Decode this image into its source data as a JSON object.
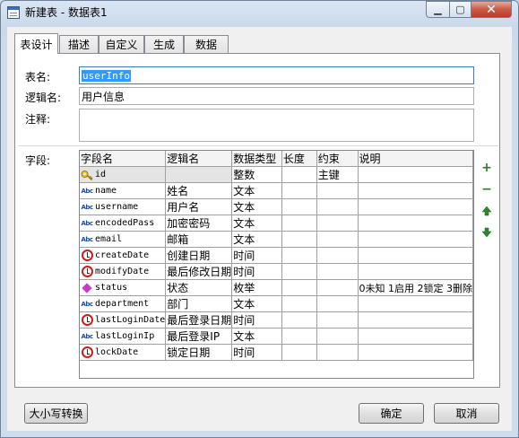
{
  "window": {
    "title": "新建表 - 数据表1"
  },
  "tabs": [
    {
      "label": "表设计",
      "active": true
    },
    {
      "label": "描述"
    },
    {
      "label": "自定义"
    },
    {
      "label": "生成"
    },
    {
      "label": "数据"
    }
  ],
  "form": {
    "table_name_label": "表名:",
    "table_name_value": "userInfo",
    "logic_name_label": "逻辑名:",
    "logic_name_value": "用户信息",
    "comment_label": "注释:",
    "comment_value": "",
    "fields_label": "字段:"
  },
  "grid": {
    "columns": [
      "字段名",
      "逻辑名",
      "数据类型",
      "长度",
      "约束",
      "说明"
    ],
    "rows": [
      {
        "icon": "key-icon",
        "name": "id",
        "logic": "",
        "type": "整数",
        "length": "",
        "constraint": "主键",
        "desc": ""
      },
      {
        "icon": "abc-icon",
        "name": "name",
        "logic": "姓名",
        "type": "文本",
        "length": "",
        "constraint": "",
        "desc": ""
      },
      {
        "icon": "abc-icon",
        "name": "username",
        "logic": "用户名",
        "type": "文本",
        "length": "",
        "constraint": "",
        "desc": ""
      },
      {
        "icon": "abc-icon",
        "name": "encodedPass",
        "logic": "加密密码",
        "type": "文本",
        "length": "",
        "constraint": "",
        "desc": ""
      },
      {
        "icon": "abc-icon",
        "name": "email",
        "logic": "邮箱",
        "type": "文本",
        "length": "",
        "constraint": "",
        "desc": ""
      },
      {
        "icon": "clock-icon",
        "name": "createDate",
        "logic": "创建日期",
        "type": "时间",
        "length": "",
        "constraint": "",
        "desc": ""
      },
      {
        "icon": "clock-icon",
        "name": "modifyDate",
        "logic": "最后修改日期",
        "type": "时间",
        "length": "",
        "constraint": "",
        "desc": ""
      },
      {
        "icon": "enum-icon",
        "name": "status",
        "logic": "状态",
        "type": "枚举",
        "length": "",
        "constraint": "",
        "desc": "0未知 1启用 2锁定 3删除"
      },
      {
        "icon": "abc-icon",
        "name": "department",
        "logic": "部门",
        "type": "文本",
        "length": "",
        "constraint": "",
        "desc": ""
      },
      {
        "icon": "clock-icon",
        "name": "lastLoginDate",
        "logic": "最后登录日期",
        "type": "时间",
        "length": "",
        "constraint": "",
        "desc": ""
      },
      {
        "icon": "abc-icon",
        "name": "lastLoginIp",
        "logic": "最后登录IP",
        "type": "文本",
        "length": "",
        "constraint": "",
        "desc": ""
      },
      {
        "icon": "clock-icon",
        "name": "lockDate",
        "logic": "锁定日期",
        "type": "时间",
        "length": "",
        "constraint": "",
        "desc": ""
      }
    ]
  },
  "side_buttons": {
    "add": "+",
    "remove": "−"
  },
  "buttons": {
    "case_convert": "大小写转换",
    "ok": "确定",
    "cancel": "取消"
  }
}
